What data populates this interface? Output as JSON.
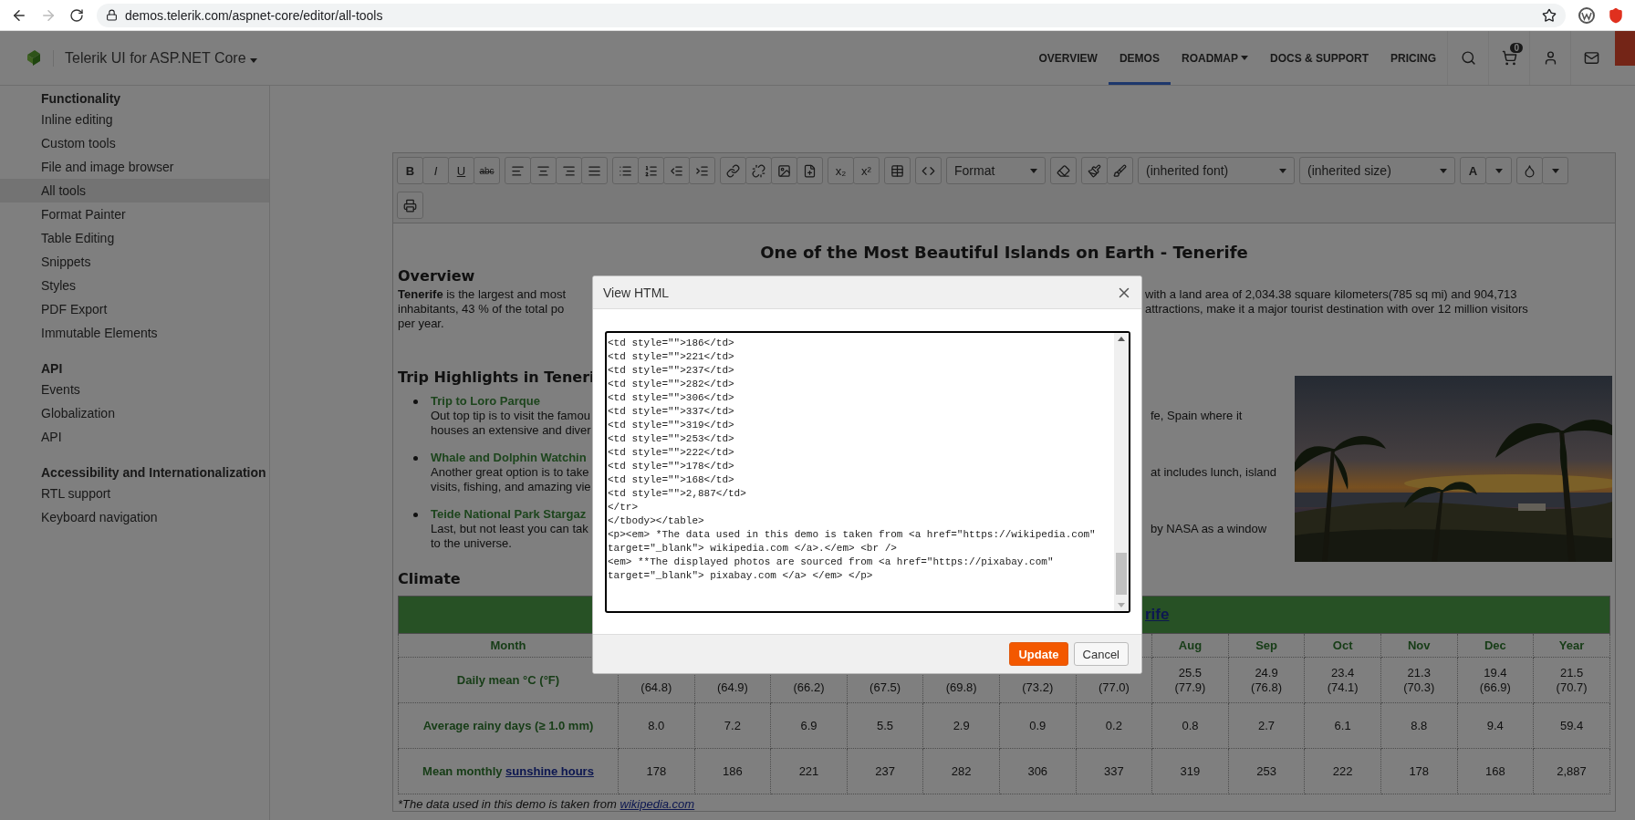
{
  "browser": {
    "url": "demos.telerik.com/aspnet-core/editor/all-tools"
  },
  "header": {
    "brand": "Telerik UI for ASP.NET Core",
    "nav": [
      {
        "label": "OVERVIEW",
        "selected": false,
        "has_menu": false
      },
      {
        "label": "DEMOS",
        "selected": true,
        "has_menu": false
      },
      {
        "label": "ROADMAP",
        "selected": false,
        "has_menu": true
      },
      {
        "label": "DOCS & SUPPORT",
        "selected": false,
        "has_menu": false
      },
      {
        "label": "PRICING",
        "selected": false,
        "has_menu": false
      }
    ],
    "cart_count": "0"
  },
  "sidebar": {
    "groups": [
      {
        "title": "Functionality",
        "items": [
          {
            "label": "Inline editing",
            "selected": false
          },
          {
            "label": "Custom tools",
            "selected": false
          },
          {
            "label": "File and image browser",
            "selected": false
          },
          {
            "label": "All tools",
            "selected": true
          },
          {
            "label": "Format Painter",
            "selected": false
          },
          {
            "label": "Table Editing",
            "selected": false
          },
          {
            "label": "Snippets",
            "selected": false
          },
          {
            "label": "Styles",
            "selected": false
          },
          {
            "label": "PDF Export",
            "selected": false
          },
          {
            "label": "Immutable Elements",
            "selected": false
          }
        ]
      },
      {
        "title": "API",
        "items": [
          {
            "label": "Events",
            "selected": false
          },
          {
            "label": "Globalization",
            "selected": false
          },
          {
            "label": "API",
            "selected": false
          }
        ]
      },
      {
        "title": "Accessibility and Internationalization",
        "items": [
          {
            "label": "RTL support",
            "selected": false
          },
          {
            "label": "Keyboard navigation",
            "selected": false
          }
        ]
      }
    ]
  },
  "editor": {
    "toolbar": {
      "format_buttons": [
        "B",
        "I",
        "U",
        "abc"
      ],
      "script_buttons": [
        "x₂",
        "x²"
      ],
      "dropdowns": [
        {
          "value": "Format"
        },
        {
          "value": "(inherited font)"
        },
        {
          "value": "(inherited size)"
        }
      ],
      "color_button": "A"
    },
    "title": "One of the Most Beautiful Islands on Earth - Tenerife",
    "overview": {
      "heading": "Overview",
      "lines": [
        {
          "left": "**Tenerife** is the largest and most",
          "right": "with a land area of 2,034.38 square kilometers(785 sq mi) and 904,713"
        },
        {
          "left": "inhabitants, 43 % of the total po",
          "right": "attractions, make it a major tourist destination with over 12 million visitors"
        },
        {
          "left": "per year."
        }
      ]
    },
    "highlights": {
      "heading": "Trip Highlights in Teneri",
      "items": [
        {
          "title": "Trip to Loro Parque",
          "lines": [
            {
              "left": "Out top tip is to visit the famou",
              "right": "fe, Spain where it"
            },
            {
              "left": "houses an extensive and diver"
            }
          ]
        },
        {
          "title": "Whale and Dolphin Watchin",
          "lines": [
            {
              "left": "Another great option is to take",
              "right": "at includes lunch, island"
            },
            {
              "left": "visits, fishing, and amazing vie"
            }
          ]
        },
        {
          "title": "Teide National Park Stargaz",
          "lines": [
            {
              "left": "Last, but not least you can tak",
              "right": "by NASA as a window"
            },
            {
              "left": "to the universe."
            }
          ]
        }
      ]
    },
    "climate": {
      "heading": "Climate",
      "caption": "rife",
      "columns": [
        "Month",
        "Aug",
        "Sep",
        "Oct",
        "Nov",
        "Dec",
        "Year"
      ],
      "rows": [
        {
          "label": "Daily mean °C (°F)",
          "values": [
            "(64.8)",
            "(64.9)",
            "(66.2)",
            "(67.5)",
            "(69.8)",
            "(73.2)",
            "(77.0)",
            "25.5\n(77.9)",
            "24.9\n(76.8)",
            "23.4\n(74.1)",
            "21.3\n(70.3)",
            "19.4\n(66.9)",
            "21.5\n(70.7)"
          ]
        },
        {
          "label": "Average rainy days (≥ 1.0 mm)",
          "values": [
            "8.0",
            "7.2",
            "6.9",
            "5.5",
            "2.9",
            "0.9",
            "0.2",
            "0.8",
            "2.7",
            "6.1",
            "8.8",
            "9.4",
            "59.4"
          ]
        },
        {
          "label": "Mean monthly",
          "link": "sunshine hours",
          "values": [
            "178",
            "186",
            "221",
            "237",
            "282",
            "306",
            "337",
            "319",
            "253",
            "222",
            "178",
            "168",
            "2,887"
          ]
        }
      ],
      "note": "*The data used in this demo is taken from",
      "note_link": "wikipedia.com"
    }
  },
  "dialog": {
    "title": "View HTML",
    "code_lines": [
      "<td style=\"\">186</td>",
      "<td style=\"\">221</td>",
      "<td style=\"\">237</td>",
      "<td style=\"\">282</td>",
      "<td style=\"\">306</td>",
      "<td style=\"\">337</td>",
      "<td style=\"\">319</td>",
      "<td style=\"\">253</td>",
      "<td style=\"\">222</td>",
      "<td style=\"\">178</td>",
      "<td style=\"\">168</td>",
      "<td style=\"\">2,887</td>",
      "</tr>",
      "</tbody></table>",
      "<p><em> *The data used in this demo is taken from <a href=\"https://wikipedia.com\"",
      "target=\"_blank\"> wikipedia.com </a>.</em> <br />",
      "<em> **The displayed photos are sourced from <a href=\"https://pixabay.com\"",
      "target=\"_blank\"> pixabay.com </a> </em> </p>"
    ],
    "buttons": [
      {
        "label": "Update",
        "kind": "primary"
      },
      {
        "label": "Cancel",
        "kind": "secondary"
      }
    ]
  }
}
